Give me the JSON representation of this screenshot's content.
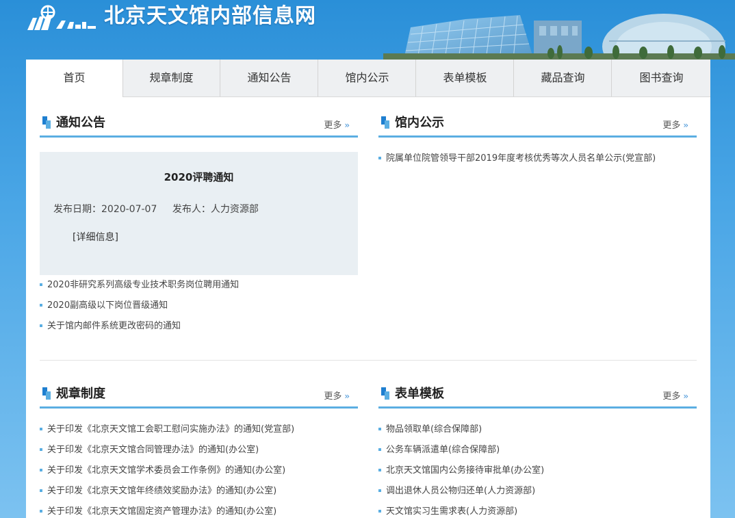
{
  "header": {
    "site_title": "北京天文馆内部信息网",
    "logo_icon": "planetarium-logo-icon"
  },
  "nav": {
    "items": [
      {
        "label": "首页",
        "active": true
      },
      {
        "label": "规章制度"
      },
      {
        "label": "通知公告"
      },
      {
        "label": "馆内公示"
      },
      {
        "label": "表单模板"
      },
      {
        "label": "藏品查询"
      },
      {
        "label": "图书查询"
      }
    ]
  },
  "notices": {
    "title": "通知公告",
    "more_label": "更多",
    "more_icon": "double-chevron-right-icon",
    "featured": {
      "title": "2020评聘通知",
      "date_text": "发布日期：2020-07-07",
      "publisher_text": "发布人：人力资源部",
      "detail_link": "[详细信息]"
    },
    "items": [
      "2020非研究系列高级专业技术职务岗位聘用通知",
      "2020副高级以下岗位晋级通知",
      "关于馆内邮件系统更改密码的通知"
    ]
  },
  "publicity": {
    "title": "馆内公示",
    "more_label": "更多",
    "items": [
      "院属单位院管领导干部2019年度考核优秀等次人员名单公示(党宣部)"
    ]
  },
  "regulations": {
    "title": "规章制度",
    "more_label": "更多",
    "items": [
      "关于印发《北京天文馆工会职工慰问实施办法》的通知(党宣部)",
      "关于印发《北京天文馆合同管理办法》的通知(办公室)",
      "关于印发《北京天文馆学术委员会工作条例》的通知(办公室)",
      "关于印发《北京天文馆年终绩效奖励办法》的通知(办公室)",
      "关于印发《北京天文馆固定资产管理办法》的通知(办公室)"
    ]
  },
  "forms": {
    "title": "表单模板",
    "more_label": "更多",
    "items": [
      "物品领取单(综合保障部)",
      "公务车辆派遣单(综合保障部)",
      "北京天文馆国内公务接待审批单(办公室)",
      "调出退休人员公物归还单(人力资源部)",
      "天文馆实习生需求表(人力资源部)"
    ]
  },
  "colors": {
    "accent": "#5aaee2",
    "accent_dark": "#1f7fd0",
    "background": "#2a8fd8"
  }
}
